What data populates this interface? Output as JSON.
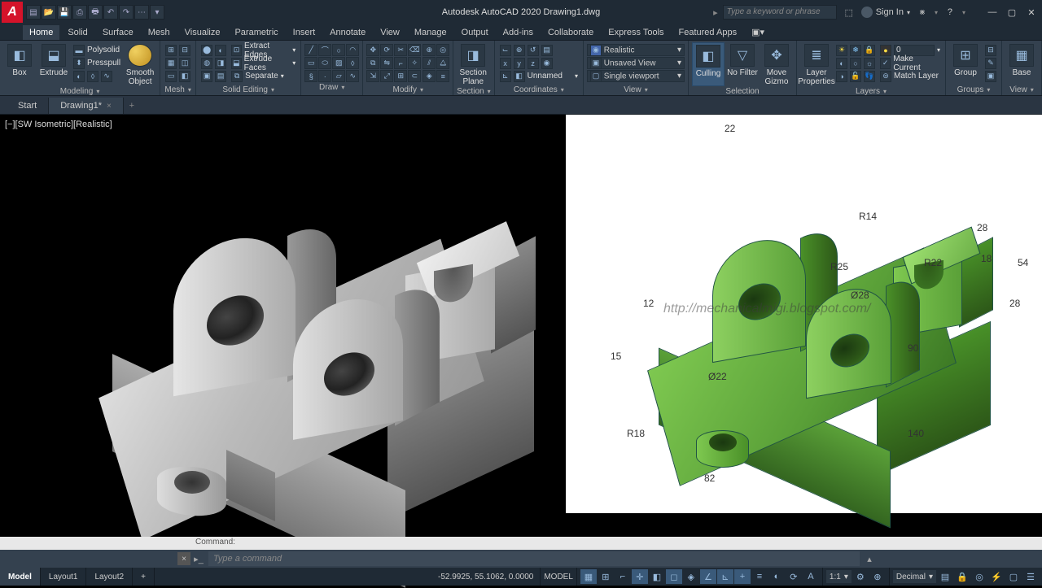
{
  "app": {
    "title": "Autodesk AutoCAD 2020   Drawing1.dwg",
    "logo": "A"
  },
  "qat_icons": [
    "new",
    "open",
    "save",
    "saveas",
    "plot",
    "undo",
    "redo",
    "workspace",
    "dd"
  ],
  "search": {
    "placeholder": "Type a keyword or phrase"
  },
  "signin": {
    "label": "Sign In"
  },
  "menu": {
    "items": [
      "Home",
      "Solid",
      "Surface",
      "Mesh",
      "Visualize",
      "Parametric",
      "Insert",
      "Annotate",
      "View",
      "Manage",
      "Output",
      "Add-ins",
      "Collaborate",
      "Express Tools",
      "Featured Apps"
    ],
    "active": "Home"
  },
  "ribbon": {
    "modeling": {
      "title": "Modeling",
      "box": "Box",
      "extrude": "Extrude",
      "polysolid": "Polysolid",
      "presspull": "Presspull",
      "smooth": "Smooth\nObject"
    },
    "mesh": {
      "title": "Mesh"
    },
    "solidedit": {
      "title": "Solid Editing",
      "extract": "Extract Edges",
      "extrudefaces": "Extrude Faces",
      "separate": "Separate"
    },
    "draw": {
      "title": "Draw"
    },
    "modify": {
      "title": "Modify"
    },
    "section": {
      "title": "Section",
      "plane": "Section\nPlane"
    },
    "coordinates": {
      "title": "Coordinates",
      "unnamed": "Unnamed"
    },
    "view": {
      "title": "View",
      "realistic": "Realistic",
      "unsaved": "Unsaved View",
      "single": "Single viewport"
    },
    "selection": {
      "title": "Selection",
      "culling": "Culling",
      "nofilter": "No Filter",
      "gizmo": "Move\nGizmo"
    },
    "layers": {
      "title": "Layers",
      "props": "Layer\nProperties",
      "makecurrent": "Make Current",
      "matchlayer": "Match Layer"
    },
    "groups": {
      "title": "Groups",
      "group": "Group"
    },
    "viewpanel": {
      "title": "View",
      "base": "Base"
    }
  },
  "doctabs": {
    "start": "Start",
    "drawing": "Drawing1*"
  },
  "viewport": {
    "label": "[−][SW Isometric][Realistic]"
  },
  "reference": {
    "watermark": "http://mechanicalmigi.blogspot.com/",
    "dims": {
      "d22": "22",
      "r14": "R14",
      "d28t": "28",
      "d18": "18",
      "d54": "54",
      "d28r": "28",
      "r25": "R25",
      "phi28": "Ø28",
      "r22": "R22",
      "d90": "90",
      "d12": "12",
      "d15": "15",
      "phi22": "Ø22",
      "r18": "R18",
      "d82": "82",
      "d140": "140"
    }
  },
  "cmd": {
    "hist": "Command:",
    "placeholder": "Type a command"
  },
  "status": {
    "tabs": [
      "Model",
      "Layout1",
      "Layout2"
    ],
    "coords": "-52.9925, 55.1062, 0.0000",
    "model": "MODEL",
    "scale": "1:1",
    "decimal": "Decimal"
  }
}
